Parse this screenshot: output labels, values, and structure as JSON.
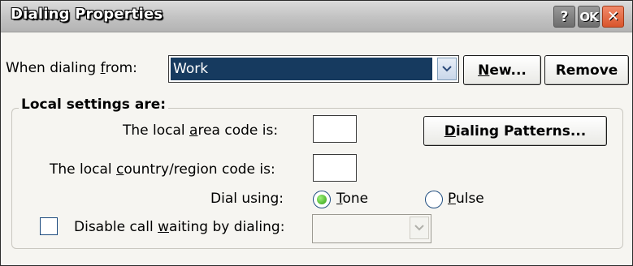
{
  "window": {
    "title": "Dialing Properties",
    "help_label": "?",
    "ok_label": "OK",
    "close_label": "✕"
  },
  "from": {
    "label_pre": "When dialing ",
    "label_key": "f",
    "label_post": "rom:",
    "value": "Work"
  },
  "buttons": {
    "new_key": "N",
    "new_rest": "ew...",
    "remove_label": "Remove",
    "patterns_key": "D",
    "patterns_rest": "ialing Patterns..."
  },
  "local": {
    "heading": "Local settings are:",
    "area_pre": "The local ",
    "area_key": "a",
    "area_post": "rea code is:",
    "area_value": "",
    "country_pre": "The local ",
    "country_key": "c",
    "country_post": "ountry/region code is:",
    "country_value": ""
  },
  "dial": {
    "label": "Dial using:",
    "tone_key": "T",
    "tone_rest": "one",
    "pulse_key": "P",
    "pulse_rest": "ulse",
    "selected": "tone"
  },
  "call_waiting": {
    "label_pre": "Disable call ",
    "label_key": "w",
    "label_post": "aiting by dialing:",
    "checked": false,
    "value": ""
  }
}
